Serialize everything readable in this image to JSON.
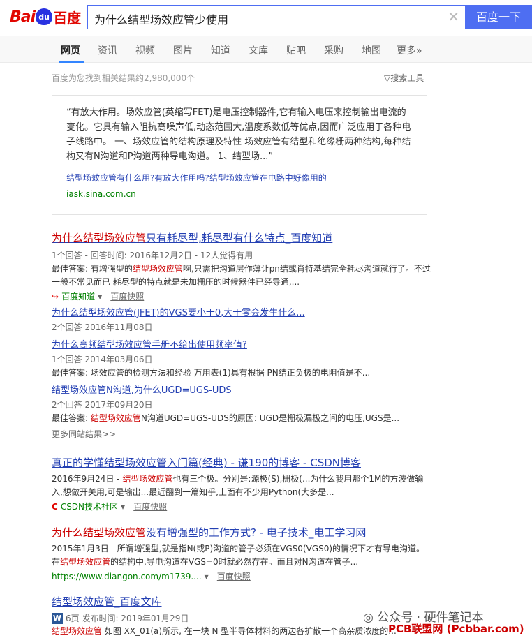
{
  "header": {
    "logo_bai": "Bai",
    "logo_du": "du",
    "logo_cn": "百度",
    "query": "为什么结型场效应管少使用",
    "search_button": "百度一下"
  },
  "nav": {
    "tabs": [
      "网页",
      "资讯",
      "视频",
      "图片",
      "知道",
      "文库",
      "贴吧",
      "采购",
      "地图",
      "更多»"
    ]
  },
  "meta": {
    "result_count": "百度为您找到相关结果约2,980,000个",
    "search_tools": "搜索工具"
  },
  "answer_box": {
    "text": "“有放大作用。场效应管(英缩写FET)是电压控制器件,它有输入电压来控制输出电流的变化。它具有输入阻抗高噪声低,动态范围大,温度系数低等优点,因而广泛应用于各种电子线路中。   一、场效应管的结构原理及特性  场效应管有结型和绝缘栅两种结构,每种结构又有N沟道和P沟道两种导电沟道。 1、结型场...”",
    "source_title": "结型场效应管有什么用?有放大作用吗?结型场效应管在电路中好像用的",
    "source_url": "iask.sina.com.cn"
  },
  "results": {
    "r1": {
      "title_a": "为什么结型场效应管",
      "title_b": "只有耗尽型,耗尽型有什么特点_百度知道",
      "meta": "1个回答 - 回答时间: 2016年12月2日 - 12人觉得有用",
      "snip_a": "最佳答案: 有增强型的",
      "snip_em": "结型场效应管",
      "snip_b": "啊,只需把沟道层作薄让pn结或肖特基结完全耗尽沟道就行了。不过一般不常见而已 耗尽型的特点就是未加栅压的时候器件已经导通,...",
      "source": "百度知道",
      "kuaizhao": "百度快照",
      "sub1_title": "为什么结型场效应管(JFET)的VGS要小于0,大于零会发生什么...",
      "sub1_meta": "2个回答  2016年11月08日",
      "sub2_title": "为什么高频结型场效应管手册不给出使用频率值?",
      "sub2_meta": "1个回答  2014年03月06日",
      "sub2_snip": "最佳答案: 场效应管的检测方法和经验 万用表(1)具有根据 PN结正负极的电阻值是不...",
      "sub3_title": "结型场效应管N沟道,为什么UGD=UGS-UDS",
      "sub3_meta": "2个回答  2017年09月20日",
      "sub3_snip_a": "最佳答案: ",
      "sub3_snip_em": "结型场效应管",
      "sub3_snip_b": "N沟道UGD=UGS-UDS的原因: UGD是栅极漏极之间的电压,UGS是...",
      "more": "更多同站结果>>"
    },
    "r2": {
      "title": "真正的学懂结型场效应管入门篇(经典) - 谦190的博客 - CSDN博客",
      "snip_a": "2016年9月24日 - ",
      "snip_em": "结型场效应管",
      "snip_b": "也有三个极。分别是:源极(S),栅极(...为什么我用那个1M的方波做输入,想做开关用,可是输出...最近翻到一篇知乎,上面有不少用Python(大多是...",
      "source": "CSDN技术社区",
      "kuaizhao": "百度快照"
    },
    "r3": {
      "title_a": "为什么结型场效应管",
      "title_b": "没有增强型的工作方式? - 电子技术_电工学习网",
      "snip_a": "2015年1月3日 - 所谓增强型,就是指N(或P)沟道的管子必须在VGS0(VGS0)的情况下才有导电沟道。在",
      "snip_em": "结型场效应管",
      "snip_b": "的结构中,导电沟道在VGS=0时就必然存在。而且对N沟道在管子...",
      "url": "https://www.diangon.com/m1739....",
      "kuaizhao": "百度快照"
    },
    "r4": {
      "title": "结型场效应管_百度文库",
      "meta": "6页 发布时间: 2019年01月29日",
      "snip_em": "结型场效应管",
      "snip_b": " 如图 XX_01(a)所示, 在一块 N 型半导体材料的两边各扩散一个高杂质浓度的..."
    }
  },
  "watermark": {
    "line1": "公众号 · 硬件笔记本",
    "line2": "PCB联盟网 (Pcbbar.com)"
  },
  "colors": {
    "accent": "#4e6ef2",
    "link": "#2440b3",
    "highlight": "#cc0000",
    "url_green": "#008000"
  }
}
